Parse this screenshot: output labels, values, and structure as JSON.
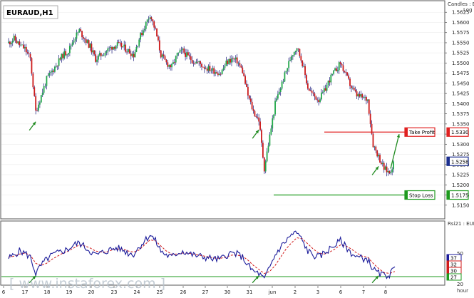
{
  "chart_data": {
    "type": "candlestick",
    "symbol": "EURAUD,H1",
    "top_right_text": "Candles : E",
    "scale_text": "Log",
    "indicator_label": "Rsi21 : EUR",
    "bottom_right_label": "hour",
    "watermark": "www.instaforex.com",
    "price_range": [
      1.5125,
      1.565
    ],
    "price_ticks": [
      "1.5625",
      "1.5600",
      "1.5575",
      "1.5550",
      "1.5525",
      "1.5500",
      "1.5475",
      "1.5450",
      "1.5425",
      "1.5400",
      "1.5375",
      "1.5350",
      "1.5325",
      "1.5300",
      "1.5275",
      "1.5250",
      "1.5225",
      "1.5200",
      "1.5175",
      "1.5150"
    ],
    "price_tick_values": [
      1.5625,
      1.56,
      1.5575,
      1.555,
      1.5525,
      1.55,
      1.5475,
      1.545,
      1.5425,
      1.54,
      1.5375,
      1.535,
      1.5325,
      1.53,
      1.5275,
      1.525,
      1.5225,
      1.52,
      1.5175,
      1.515
    ],
    "x_ticks": [
      "6",
      "17",
      "18",
      "19",
      "20",
      "23",
      "24",
      "25",
      "26",
      "27",
      "30",
      "31",
      "jun",
      "2",
      "3",
      "6",
      "7",
      "8"
    ],
    "current_price_label": "1.5258",
    "current_price": 1.5258,
    "take_profit": {
      "label": "Take Profit",
      "price": 1.533,
      "price_label": "1.5330"
    },
    "stop_loss": {
      "label": "Stop Loss",
      "price": 1.5175,
      "price_label": "1.5175"
    },
    "price_series": [
      1.555,
      1.556,
      1.5545,
      1.5535,
      1.551,
      1.538,
      1.542,
      1.546,
      1.548,
      1.55,
      1.552,
      1.553,
      1.556,
      1.558,
      1.556,
      1.554,
      1.551,
      1.552,
      1.553,
      1.554,
      1.5545,
      1.554,
      1.553,
      1.552,
      1.556,
      1.559,
      1.562,
      1.558,
      1.552,
      1.55,
      1.549,
      1.552,
      1.553,
      1.5515,
      1.5505,
      1.55,
      1.549,
      1.5485,
      1.548,
      1.5475,
      1.55,
      1.551,
      1.5505,
      1.548,
      1.542,
      1.538,
      1.536,
      1.524,
      1.532,
      1.54,
      1.544,
      1.548,
      1.552,
      1.554,
      1.55,
      1.544,
      1.542,
      1.541,
      1.543,
      1.546,
      1.548,
      1.55,
      1.547,
      1.544,
      1.542,
      1.5415,
      1.541,
      1.53,
      1.527,
      1.524,
      1.523,
      1.526
    ],
    "arrows": [
      {
        "series": "price",
        "x_index": 5
      },
      {
        "series": "price",
        "x_index": 46
      },
      {
        "series": "price",
        "x_index": 68
      }
    ],
    "target_arrow_from": 1.524,
    "target_arrow_to": 1.5325,
    "rsi": {
      "ylim": [
        20,
        80
      ],
      "ticks": [
        "50",
        "32",
        "30",
        "27",
        "20"
      ],
      "tick_values": [
        50,
        32,
        30,
        27,
        20
      ],
      "level_line": 27,
      "values": [
        45,
        48,
        52,
        50,
        46,
        30,
        38,
        44,
        48,
        50,
        52,
        54,
        58,
        60,
        56,
        52,
        48,
        50,
        52,
        54,
        55,
        53,
        50,
        49,
        56,
        62,
        68,
        62,
        52,
        48,
        46,
        50,
        52,
        50,
        48,
        47,
        46,
        45,
        44,
        44,
        48,
        50,
        49,
        46,
        38,
        32,
        30,
        24,
        36,
        48,
        56,
        62,
        68,
        70,
        62,
        52,
        48,
        46,
        50,
        54,
        58,
        62,
        56,
        50,
        46,
        45,
        44,
        34,
        30,
        28,
        29,
        35
      ],
      "signal_values": [
        46,
        47,
        49,
        50,
        48,
        40,
        38,
        40,
        44,
        47,
        50,
        52,
        55,
        58,
        57,
        55,
        52,
        51,
        51,
        53,
        54,
        54,
        52,
        51,
        53,
        58,
        63,
        62,
        57,
        52,
        49,
        49,
        50,
        50,
        49,
        48,
        47,
        46,
        45,
        45,
        46,
        48,
        48,
        47,
        43,
        38,
        34,
        30,
        32,
        38,
        46,
        54,
        60,
        65,
        64,
        59,
        54,
        50,
        49,
        51,
        54,
        58,
        57,
        54,
        50,
        47,
        46,
        40,
        35,
        31,
        30,
        32
      ],
      "value_labels": [
        "37",
        "32",
        "30",
        "27"
      ]
    },
    "colors": {
      "up": "#22a84a",
      "down": "#cc1a1a",
      "take_profit": "#e02020",
      "stop_loss": "#1e9a1e",
      "current": "#1c2f8f",
      "rsi_line": "#1a1a9a",
      "rsi_signal": "#d01a1a",
      "level_line": "#1e9a1e",
      "arrow": "#1e8a1e"
    }
  }
}
